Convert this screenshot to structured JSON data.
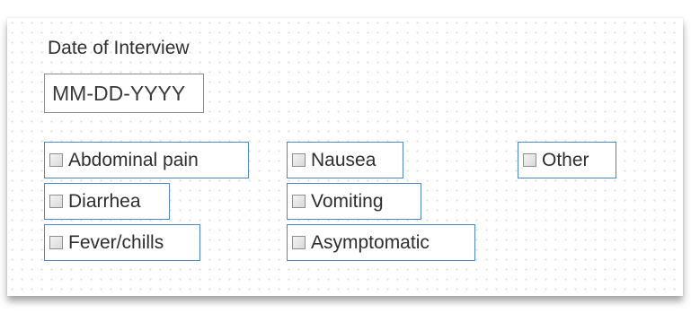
{
  "form": {
    "date_label": "Date of Interview",
    "date_placeholder": "MM-DD-YYYY",
    "date_value": ""
  },
  "checkboxes": [
    {
      "label": "Abdominal pain",
      "checked": false
    },
    {
      "label": "Diarrhea",
      "checked": false
    },
    {
      "label": "Fever/chills",
      "checked": false
    },
    {
      "label": "Nausea",
      "checked": false
    },
    {
      "label": "Vomiting",
      "checked": false
    },
    {
      "label": "Asymptomatic",
      "checked": false
    },
    {
      "label": "Other",
      "checked": false
    }
  ],
  "colors": {
    "selection_border": "#4a86d0",
    "grid_dot": "#d9dde3"
  }
}
